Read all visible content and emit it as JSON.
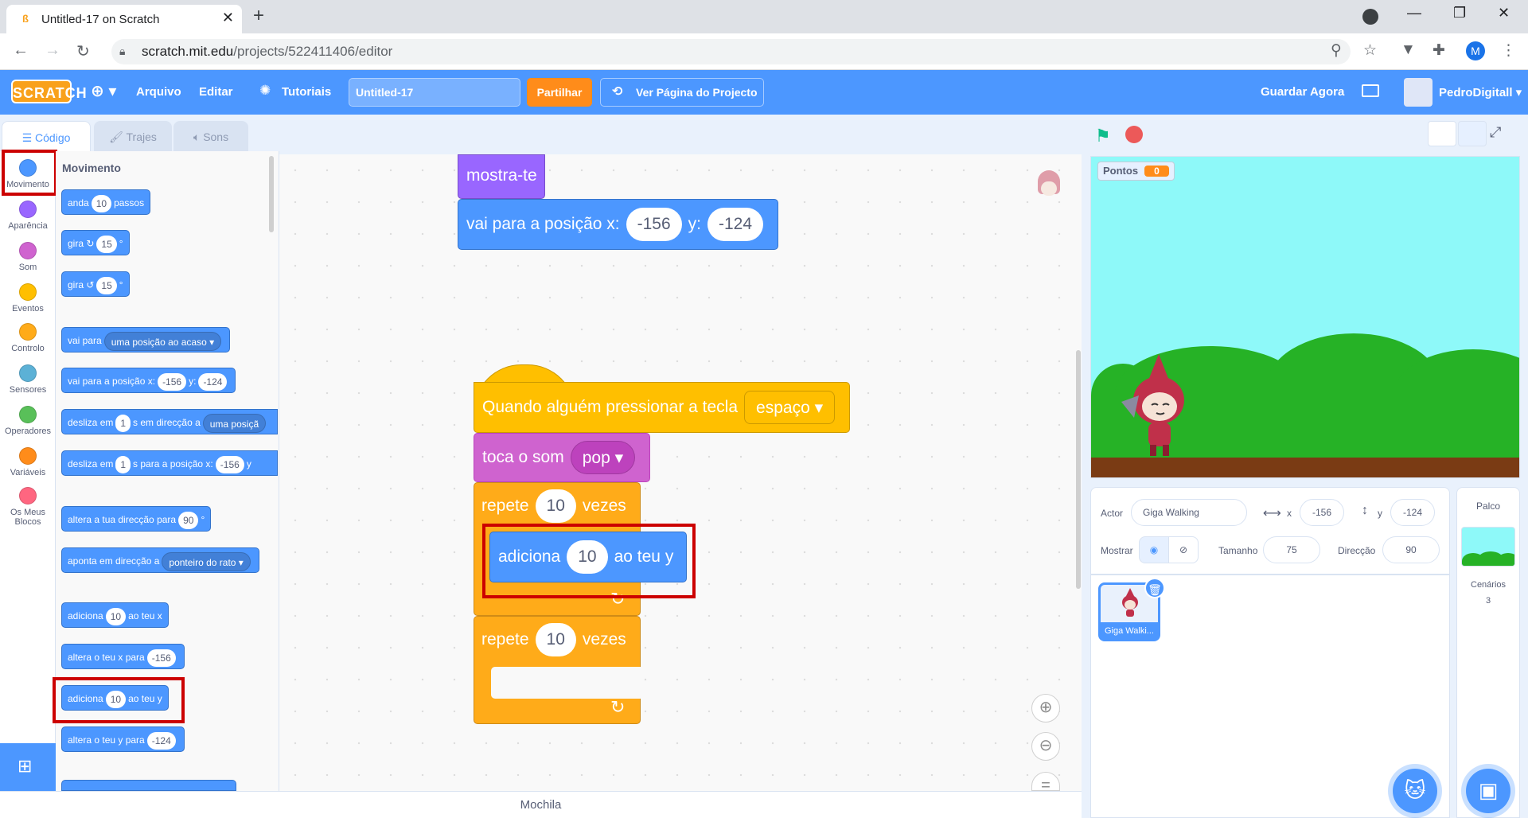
{
  "browser": {
    "tab_title": "Untitled-17 on Scratch",
    "url_domain": "scratch.mit.edu",
    "url_path": "/projects/522411406/editor",
    "profile_initial": "M"
  },
  "menubar": {
    "logo": "SCRATCH",
    "file": "Arquivo",
    "edit": "Editar",
    "tutorials": "Tutoriais",
    "project_title": "Untitled-17",
    "share": "Partilhar",
    "project_page": "Ver Página do Projecto",
    "save_now": "Guardar Agora",
    "username": "PedroDigitall"
  },
  "editor_tabs": {
    "code": "Código",
    "costumes": "Trajes",
    "sounds": "Sons"
  },
  "categories": [
    {
      "label": "Movimento",
      "color": "#4c97ff"
    },
    {
      "label": "Aparência",
      "color": "#9966ff"
    },
    {
      "label": "Som",
      "color": "#cf63cf"
    },
    {
      "label": "Eventos",
      "color": "#ffbf00"
    },
    {
      "label": "Controlo",
      "color": "#ffab19"
    },
    {
      "label": "Sensores",
      "color": "#5cb1d6"
    },
    {
      "label": "Operadores",
      "color": "#59c059"
    },
    {
      "label": "Variáveis",
      "color": "#ff8c1a"
    },
    {
      "label": "Os Meus Blocos",
      "color": "#ff6680"
    }
  ],
  "palette": {
    "heading": "Movimento",
    "move": {
      "a": "anda",
      "v": "10",
      "b": "passos"
    },
    "turn_right": {
      "a": "gira",
      "v": "15",
      "b": "°"
    },
    "turn_left": {
      "a": "gira",
      "v": "15",
      "b": "°"
    },
    "goto": {
      "a": "vai para",
      "dd": "uma posição ao acaso"
    },
    "goto_xy": {
      "a": "vai para a posição x:",
      "x": "-156",
      "b": "y:",
      "y": "-124"
    },
    "glide_to": {
      "a": "desliza em",
      "v": "1",
      "b": "s em direcção a",
      "dd": "uma posiçã"
    },
    "glide_xy": {
      "a": "desliza em",
      "v": "1",
      "b": "s para a posição x:",
      "x": "-156",
      "c": "y"
    },
    "point_dir": {
      "a": "altera a tua direcção para",
      "v": "90",
      "b": "°"
    },
    "point_towards": {
      "a": "aponta em direcção a",
      "dd": "ponteiro do rato"
    },
    "change_x": {
      "a": "adiciona",
      "v": "10",
      "b": "ao teu x"
    },
    "set_x": {
      "a": "altera o teu x para",
      "v": "-156"
    },
    "change_y": {
      "a": "adiciona",
      "v": "10",
      "b": "ao teu y"
    },
    "set_y": {
      "a": "altera o teu y para",
      "v": "-124"
    }
  },
  "script": {
    "show": "mostra-te",
    "goto": {
      "a": "vai para a posição x:",
      "x": "-156",
      "b": "y:",
      "y": "-124"
    },
    "hat": {
      "a": "Quando alguém pressionar a tecla",
      "key": "espaço"
    },
    "play": {
      "a": "toca o som",
      "sound": "pop"
    },
    "repeat1": {
      "a": "repete",
      "v": "10",
      "b": "vezes"
    },
    "change_y": {
      "a": "adiciona",
      "v": "10",
      "b": "ao teu y"
    },
    "repeat2": {
      "a": "repete",
      "v": "10",
      "b": "vezes"
    }
  },
  "backpack": "Mochila",
  "stage": {
    "monitor_label": "Pontos",
    "monitor_value": "0"
  },
  "sprite_info": {
    "sprite_label": "Actor",
    "sprite_name": "Giga Walking",
    "x_label": "x",
    "x_value": "-156",
    "y_label": "y",
    "y_value": "-124",
    "show_label": "Mostrar",
    "size_label": "Tamanho",
    "size_value": "75",
    "direction_label": "Direcção",
    "direction_value": "90"
  },
  "sprites": [
    {
      "name": "Giga Walki..."
    }
  ],
  "stage_panel": {
    "title": "Palco",
    "backdrops_label": "Cenários",
    "backdrops_count": "3"
  }
}
